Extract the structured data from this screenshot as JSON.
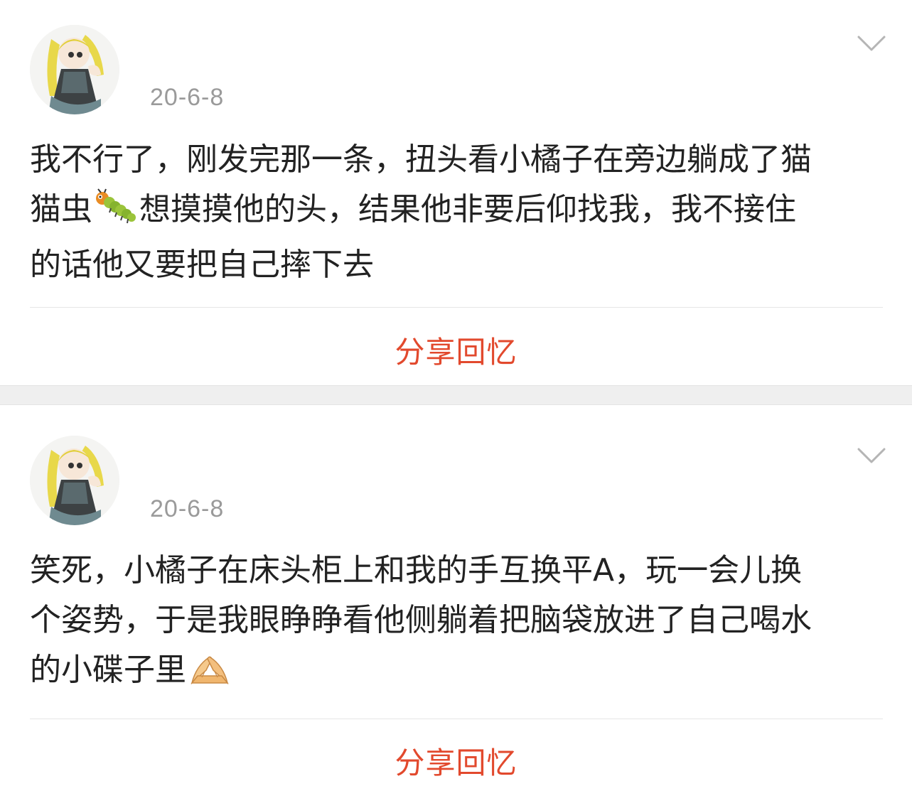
{
  "posts": [
    {
      "date": "20-6-8",
      "lines": [
        "我不行了，刚发完那一条，扭头看小橘子在旁边躺成了猫",
        "想摸摸他的头，结果他非要后仰找我，我不接住",
        "的话他又要把自己摔下去"
      ],
      "line2_prefix": "猫虫",
      "emoji": "caterpillar-emoji",
      "share_label": "分享回忆"
    },
    {
      "date": "20-6-8",
      "lines": [
        "笑死，小橘子在床头柜上和我的手互换平A，玩一会儿换",
        "个姿势，于是我眼睁睁看他侧躺着把脑袋放进了自己喝水",
        "的小碟子里"
      ],
      "emoji": "handshake-emoji",
      "share_label": "分享回忆"
    }
  ],
  "colors": {
    "share": "#e2492d",
    "date": "#9a9a9a",
    "text": "#222222",
    "separator": "#efefef"
  },
  "icons": {
    "menu": "chevron-down-icon",
    "avatar": "anime-girl-avatar"
  }
}
